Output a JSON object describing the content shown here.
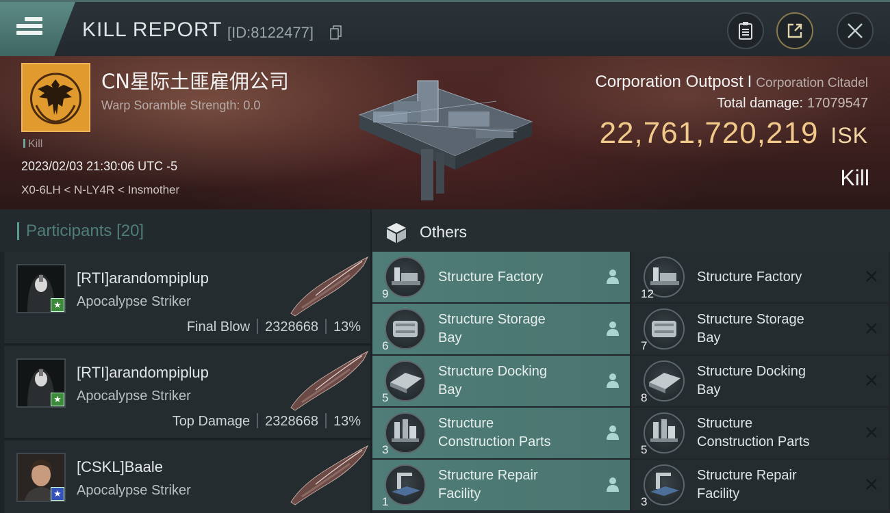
{
  "header": {
    "title": "KILL REPORT",
    "report_id": "[ID:8122477]"
  },
  "victim": {
    "corp_name": "CN星际土匪雇佣公司",
    "warp_scramble": "Warp Soramble Strength: 0.0",
    "kill_tag": "Kill",
    "datetime": "2023/02/03 21:30:06 UTC -5",
    "location": "X0-6LH < N-LY4R < Insmother",
    "ship_name": "Corporation Outpost",
    "ship_class": "Corporation Citadel",
    "total_damage_label": "Total damage:",
    "total_damage": "17079547",
    "isk_value": "22,761,720,219",
    "isk_unit": "ISK",
    "result": "Kill"
  },
  "participants": {
    "title": "Participants",
    "count": "[20]",
    "rows": [
      {
        "name": "[RTI]arandompiplup",
        "ship": "Apocalypse Striker",
        "role": "Final Blow",
        "damage": "2328668",
        "percent": "13%",
        "badge": "green"
      },
      {
        "name": "[RTI]arandompiplup",
        "ship": "Apocalypse Striker",
        "role": "Top Damage",
        "damage": "2328668",
        "percent": "13%",
        "badge": "green"
      },
      {
        "name": "[CSKL]Baale",
        "ship": "Apocalypse Striker",
        "role": "",
        "damage": "",
        "percent": "",
        "badge": "blue"
      }
    ]
  },
  "others": {
    "title": "Others",
    "dropped": [
      {
        "line1": "Structure Factory",
        "line2": "",
        "qty": "9",
        "icon": "factory-icon"
      },
      {
        "line1": "Structure Storage",
        "line2": "Bay",
        "qty": "6",
        "icon": "storage-bay-icon"
      },
      {
        "line1": "Structure Docking",
        "line2": "Bay",
        "qty": "5",
        "icon": "docking-bay-icon"
      },
      {
        "line1": "Structure",
        "line2": "Construction Parts",
        "qty": "3",
        "icon": "construction-parts-icon"
      },
      {
        "line1": "Structure Repair",
        "line2": "Facility",
        "qty": "1",
        "icon": "repair-facility-icon"
      }
    ],
    "destroyed": [
      {
        "line1": "Structure Factory",
        "line2": "",
        "qty": "12",
        "icon": "factory-icon"
      },
      {
        "line1": "Structure Storage",
        "line2": "Bay",
        "qty": "7",
        "icon": "storage-bay-icon"
      },
      {
        "line1": "Structure Docking",
        "line2": "Bay",
        "qty": "8",
        "icon": "docking-bay-icon"
      },
      {
        "line1": "Structure",
        "line2": "Construction Parts",
        "qty": "5",
        "icon": "construction-parts-icon"
      },
      {
        "line1": "Structure Repair",
        "line2": "Facility",
        "qty": "3",
        "icon": "repair-facility-icon"
      }
    ]
  },
  "colors": {
    "accent_teal": "#4f7d78",
    "isk_gold": "#f1c98a",
    "corp_logo": "#e09a2e"
  }
}
